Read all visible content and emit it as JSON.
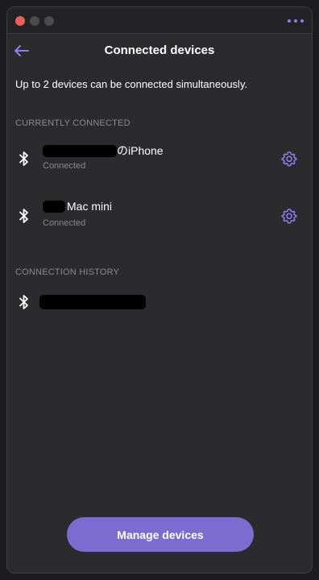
{
  "window": {
    "controls": [
      "close",
      "minimize",
      "maximize"
    ],
    "more_icon": "ellipsis-icon"
  },
  "header": {
    "title": "Connected devices",
    "back_icon": "arrow-left-icon"
  },
  "intro_text": "Up to 2 devices can be connected simultaneously.",
  "currently_connected": {
    "label": "CURRENTLY CONNECTED",
    "devices": [
      {
        "name_visible": "のiPhone",
        "name_redacted": true,
        "status": "Connected",
        "icon": "bluetooth-icon",
        "action_icon": "gear-icon"
      },
      {
        "name_visible": "Mac mini",
        "name_redacted": true,
        "status": "Connected",
        "icon": "bluetooth-icon",
        "action_icon": "gear-icon"
      }
    ]
  },
  "connection_history": {
    "label": "CONNECTION HISTORY",
    "devices": [
      {
        "name_visible": "",
        "name_redacted": true,
        "icon": "bluetooth-icon"
      }
    ]
  },
  "footer": {
    "manage_label": "Manage devices"
  },
  "colors": {
    "accent": "#8f7ef2",
    "button": "#7c6cd0",
    "background": "#2b2b2d",
    "muted_text": "#8a8a8e",
    "close": "#ec5f57"
  }
}
